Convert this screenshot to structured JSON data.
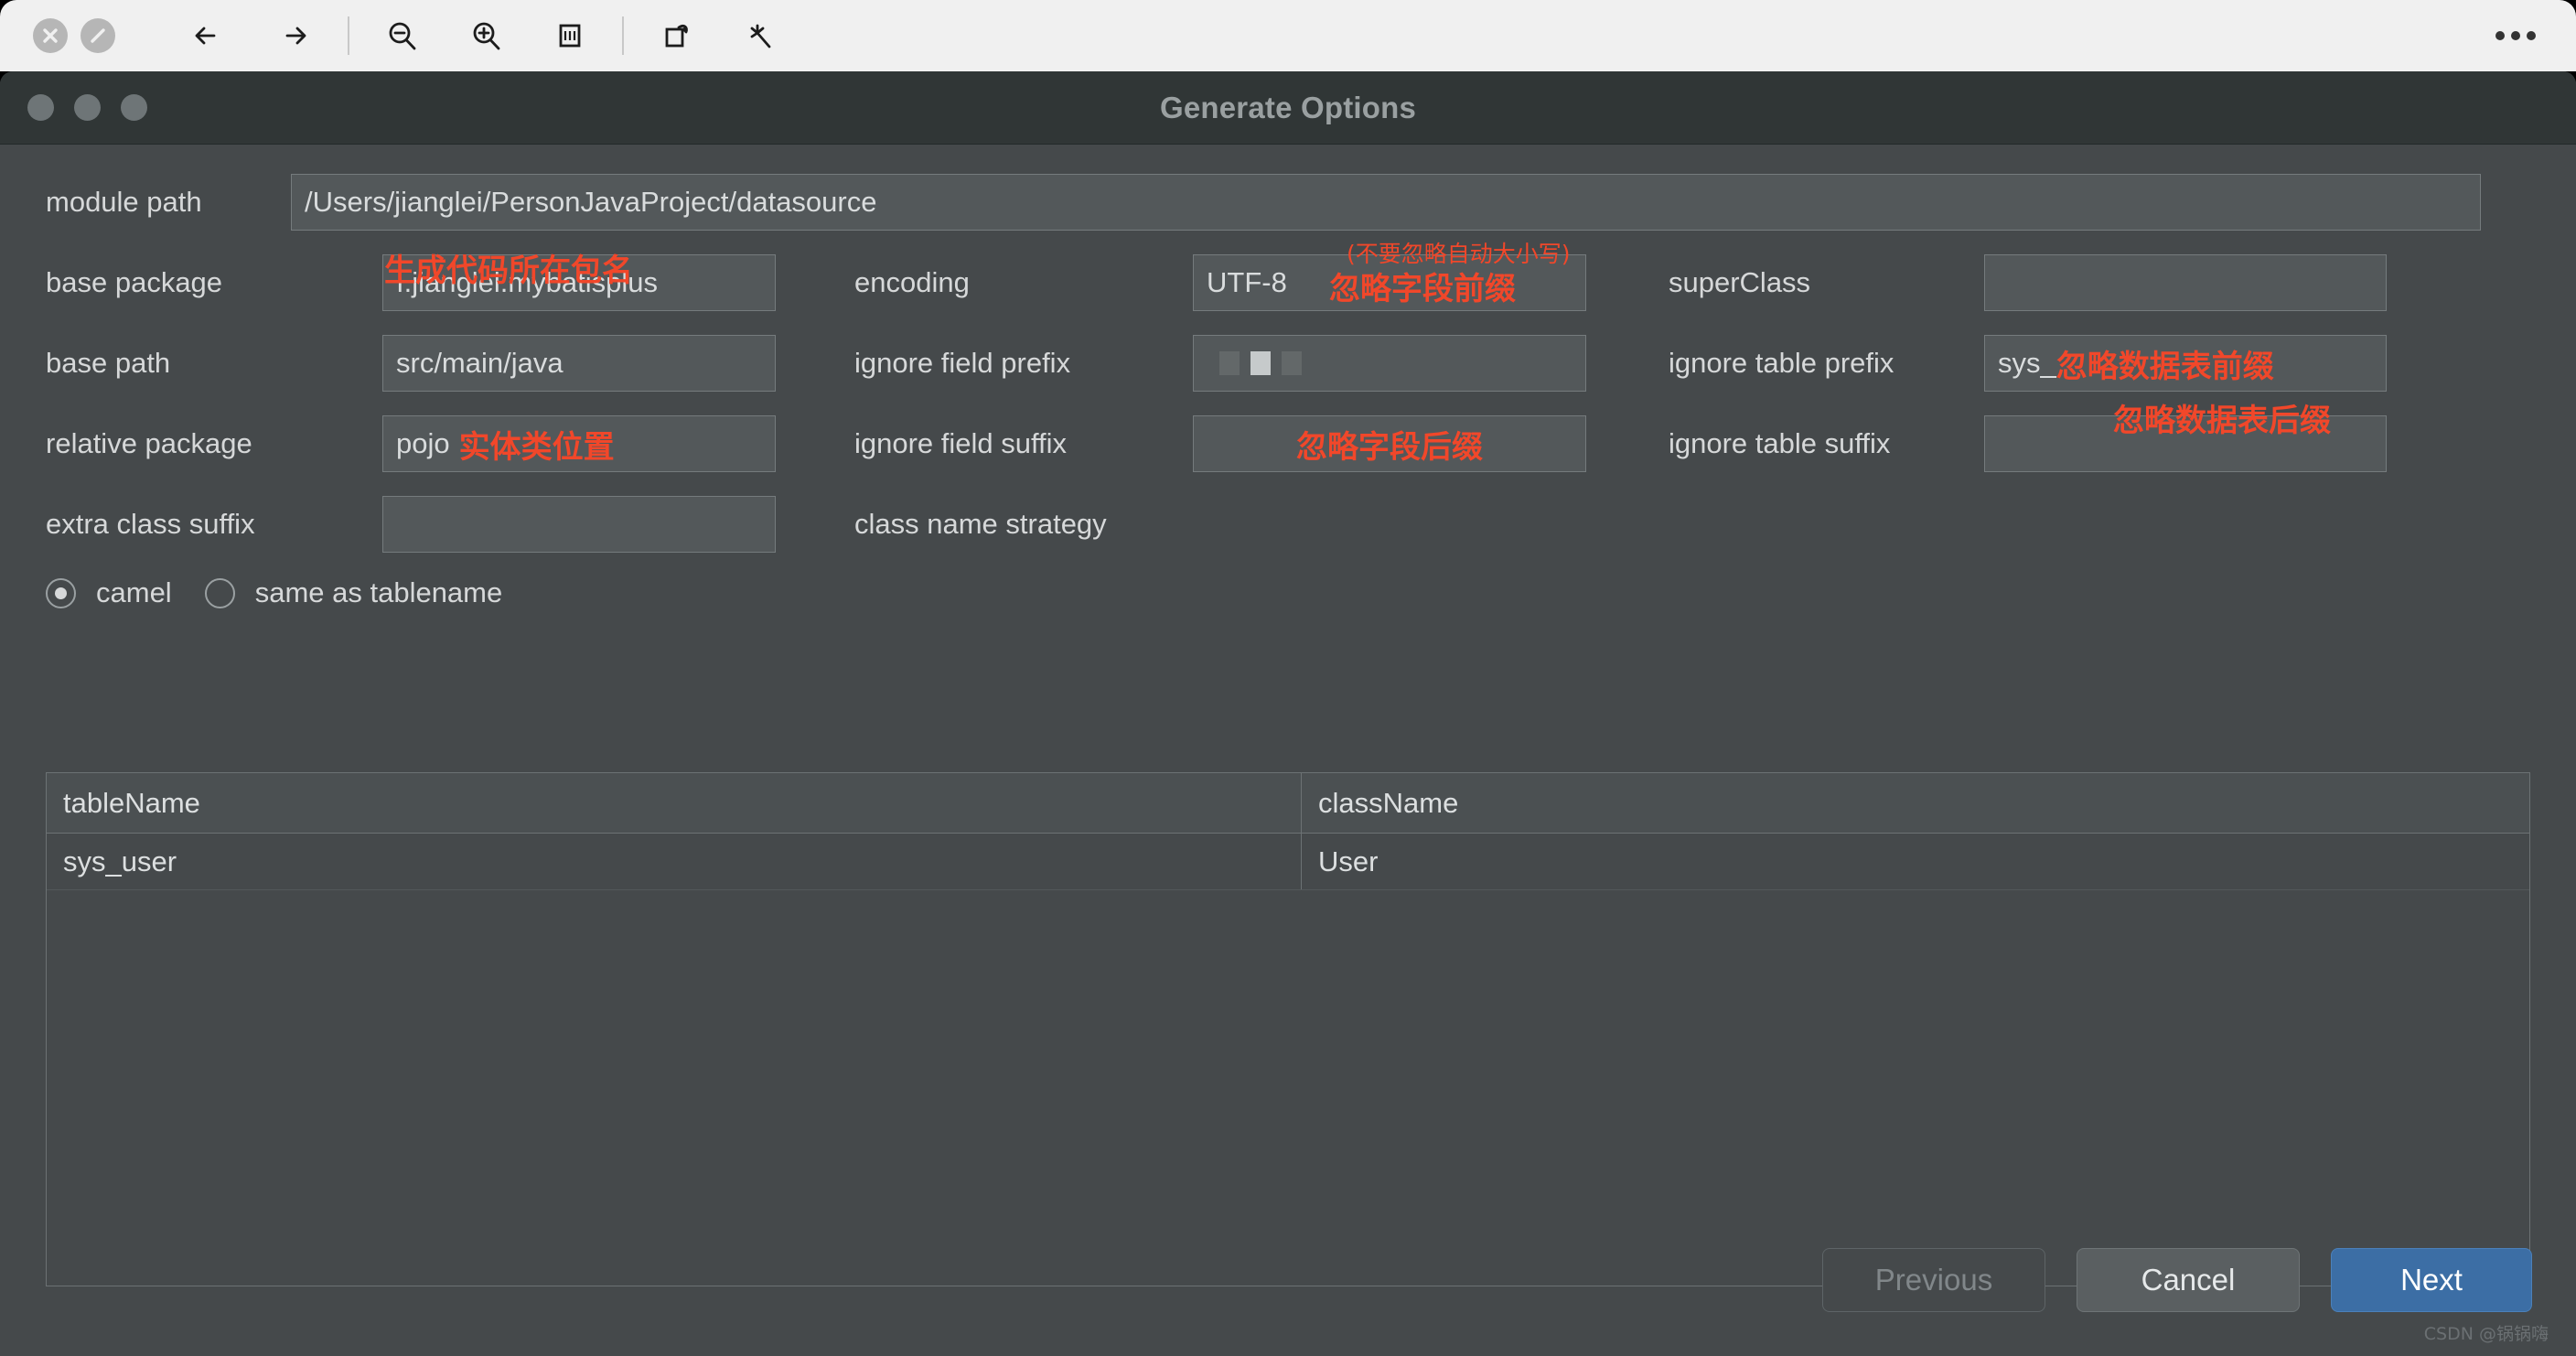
{
  "viewer_toolbar": {
    "icons": [
      {
        "name": "close-disabled-icon",
        "glyph": "✕"
      },
      {
        "name": "block-disabled-icon",
        "glyph": "⃠"
      },
      {
        "name": "back-arrow-icon",
        "glyph": "←"
      },
      {
        "name": "forward-arrow-icon",
        "glyph": "→"
      },
      {
        "name": "zoom-out-icon",
        "glyph": "⊖"
      },
      {
        "name": "zoom-in-icon",
        "glyph": "⊕"
      },
      {
        "name": "fit-width-icon",
        "glyph": "▤"
      },
      {
        "name": "rotate-icon",
        "glyph": "⟳"
      },
      {
        "name": "enhance-icon",
        "glyph": "✳"
      },
      {
        "name": "more-options-icon",
        "glyph": "⋯"
      }
    ]
  },
  "dialog": {
    "title": "Generate Options",
    "traffic_lights": [
      "close",
      "minimize",
      "maximize"
    ]
  },
  "form": {
    "module_path": {
      "label": "module path",
      "value": "/Users/jianglei/PersonJavaProject/datasource"
    },
    "base_package": {
      "label": "base package",
      "value": "ı.jianglei.mybatisplus",
      "annotation": "生成代码所在包名"
    },
    "encoding": {
      "label": "encoding",
      "value": "UTF-8"
    },
    "super_class": {
      "label": "superClass",
      "value": ""
    },
    "base_path": {
      "label": "base path",
      "value": "src/main/java"
    },
    "ignore_field_prefix": {
      "label": "ignore field prefix",
      "value": "",
      "annotation": "忽略字段前缀",
      "annotation_note": "(不要忽略自动大小写)"
    },
    "ignore_table_prefix": {
      "label": "ignore table prefix",
      "value": "sys_",
      "annotation": "忽略数据表前缀"
    },
    "relative_package": {
      "label": "relative package",
      "value": "pojo",
      "annotation": "实体类位置"
    },
    "ignore_field_suffix": {
      "label": "ignore field suffix",
      "value": "",
      "annotation": "忽略字段后缀"
    },
    "ignore_table_suffix": {
      "label": "ignore table suffix",
      "value": "",
      "annotation": "忽略数据表后缀"
    },
    "extra_class_suffix": {
      "label": "extra class suffix",
      "value": ""
    },
    "class_name_strategy": {
      "label": "class name strategy",
      "options": [
        {
          "label": "camel",
          "selected": true
        },
        {
          "label": "same as tablename",
          "selected": false
        }
      ]
    }
  },
  "table": {
    "columns": [
      "tableName",
      "className"
    ],
    "rows": [
      {
        "tableName": "sys_user",
        "className": "User"
      }
    ]
  },
  "footer": {
    "previous_label": "Previous",
    "cancel_label": "Cancel",
    "next_label": "Next"
  },
  "watermark": "CSDN @锅锅嗨",
  "colors": {
    "dialog_bg": "#45494b",
    "titlebar_bg": "#303636",
    "field_bg": "#53585a",
    "accent_primary": "#3c6ea5",
    "annotation_red": "#f1472a",
    "text": "#d6d8d9"
  }
}
